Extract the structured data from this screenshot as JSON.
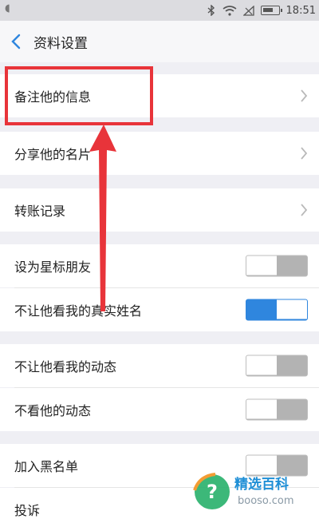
{
  "status_bar": {
    "time": "18:51",
    "icons": [
      "bluetooth-icon",
      "wifi-icon",
      "signal-icon",
      "battery-icon"
    ]
  },
  "nav": {
    "title": "资料设置",
    "back_icon": "chevron-left-icon"
  },
  "groups": [
    {
      "rows": [
        {
          "label": "备注他的信息",
          "control": "chevron"
        }
      ]
    },
    {
      "rows": [
        {
          "label": "分享他的名片",
          "control": "chevron"
        }
      ]
    },
    {
      "rows": [
        {
          "label": "转账记录",
          "control": "chevron"
        }
      ]
    },
    {
      "rows": [
        {
          "label": "设为星标朋友",
          "control": "toggle",
          "on": false
        },
        {
          "label": "不让他看我的真实姓名",
          "control": "toggle",
          "on": true
        }
      ]
    },
    {
      "rows": [
        {
          "label": "不让他看我的动态",
          "control": "toggle",
          "on": false
        },
        {
          "label": "不看他的动态",
          "control": "toggle",
          "on": false
        }
      ]
    },
    {
      "rows": [
        {
          "label": "加入黑名单",
          "control": "toggle",
          "on": false
        },
        {
          "label": "投诉",
          "control": "none"
        }
      ]
    }
  ],
  "watermark": {
    "title": "精选百科",
    "url": "booso.com"
  },
  "colors": {
    "accent": "#2f86de",
    "annotation": "#e8343a",
    "background": "#efeff4"
  }
}
